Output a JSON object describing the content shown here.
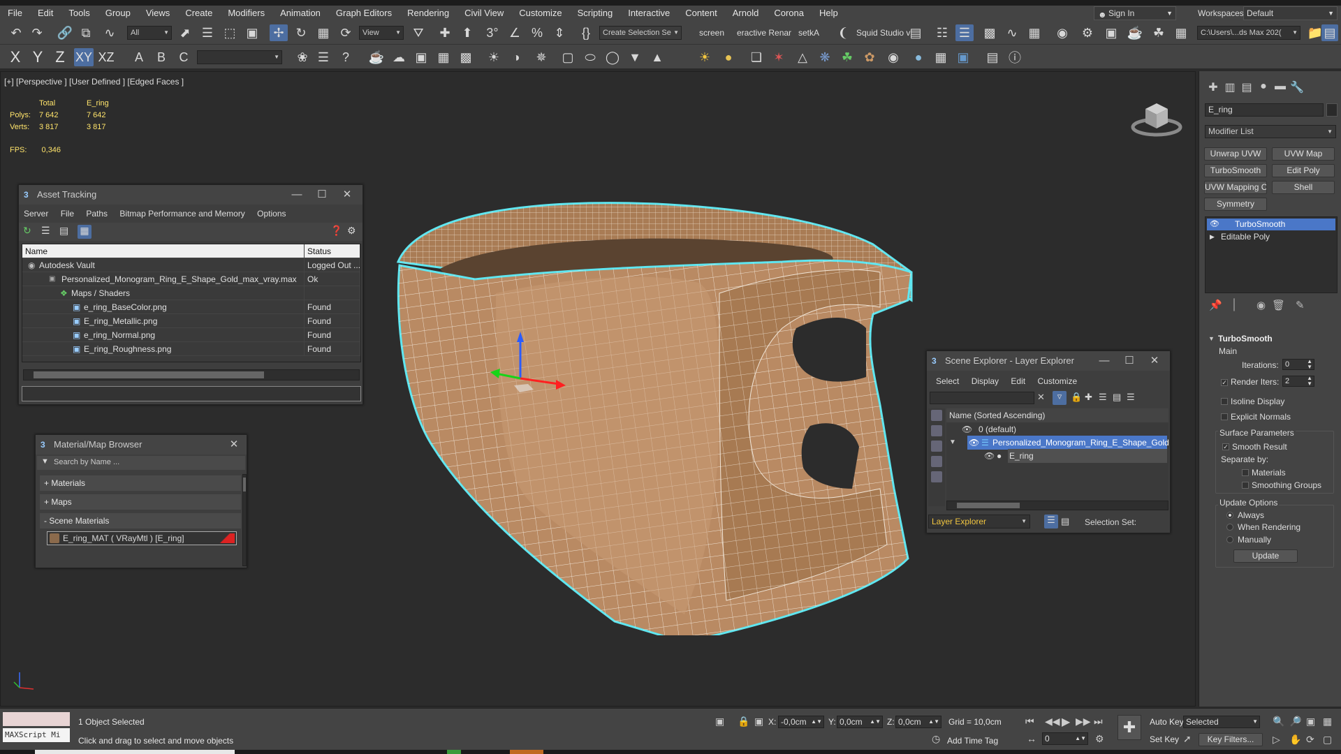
{
  "menubar": {
    "items": [
      "File",
      "Edit",
      "Tools",
      "Group",
      "Views",
      "Create",
      "Modifiers",
      "Animation",
      "Graph Editors",
      "Rendering",
      "Civil View",
      "Customize",
      "Scripting",
      "Interactive",
      "Content",
      "Arnold",
      "Corona",
      "Help"
    ],
    "signin": "Sign In",
    "workspaces_label": "Workspaces:",
    "workspace": "Default"
  },
  "toolbar": {
    "filter": "All",
    "ref_coord": "View",
    "create_selection_set": "Create Selection Se",
    "screen": "screen",
    "interactive_render": "eractive Renar",
    "setka": "setkA",
    "squid": "Squid Studio v",
    "project_path": "C:\\Users\\...ds Max 202("
  },
  "toolbar2": {
    "axes": [
      "X",
      "Y",
      "Z",
      "XY",
      "XZ"
    ]
  },
  "viewport": {
    "label": "[+] [Perspective ] [User Defined ] [Edged Faces ]",
    "stats": {
      "col_total": "Total",
      "col_object": "E_ring",
      "polys_label": "Polys:",
      "polys_total": "7 642",
      "polys_object": "7 642",
      "verts_label": "Verts:",
      "verts_total": "3 817",
      "verts_object": "3 817",
      "fps_label": "FPS:",
      "fps_value": "0,346"
    }
  },
  "asset_tracking": {
    "title": "Asset Tracking",
    "menu": [
      "Server",
      "File",
      "Paths",
      "Bitmap Performance and Memory",
      "Options"
    ],
    "col_name": "Name",
    "col_status": "Status",
    "rows": [
      {
        "name": "Autodesk Vault",
        "status": "Logged Out ..."
      },
      {
        "name": "Personalized_Monogram_Ring_E_Shape_Gold_max_vray.max",
        "status": "Ok"
      },
      {
        "name": "Maps / Shaders",
        "status": ""
      },
      {
        "name": "e_ring_BaseColor.png",
        "status": "Found"
      },
      {
        "name": "E_ring_Metallic.png",
        "status": "Found"
      },
      {
        "name": "e_ring_Normal.png",
        "status": "Found"
      },
      {
        "name": "E_ring_Roughness.png",
        "status": "Found"
      }
    ]
  },
  "material_browser": {
    "title": "Material/Map Browser",
    "search_placeholder": "Search by Name ...",
    "groups": [
      "+ Materials",
      "+ Maps",
      "- Scene Materials"
    ],
    "scene_material": "E_ring_MAT  ( VRayMtl )  [E_ring]"
  },
  "scene_explorer": {
    "title": "Scene Explorer - Layer Explorer",
    "menu": [
      "Select",
      "Display",
      "Edit",
      "Customize"
    ],
    "column": "Name (Sorted Ascending)",
    "rows": [
      "0 (default)",
      "Personalized_Monogram_Ring_E_Shape_Gold",
      "E_ring"
    ],
    "footer_mode": "Layer Explorer",
    "selection_set": "Selection Set:"
  },
  "command_panel": {
    "object_name": "E_ring",
    "modifier_list": "Modifier List",
    "buttons": [
      "Unwrap UVW",
      "UVW Map",
      "TurboSmooth",
      "Edit Poly",
      "UVW Mapping Clear",
      "Shell",
      "Symmetry"
    ],
    "stack": [
      "TurboSmooth",
      "Editable Poly"
    ],
    "turbosmooth": {
      "title": "TurboSmooth",
      "main": "Main",
      "iterations_label": "Iterations:",
      "iterations": "0",
      "render_iters_label": "Render Iters:",
      "render_iters": "2",
      "isoline": "Isoline Display",
      "explicit_normals": "Explicit Normals",
      "surface_params": "Surface Parameters",
      "smooth_result": "Smooth Result",
      "separate_by": "Separate by:",
      "materials": "Materials",
      "smoothing_groups": "Smoothing Groups",
      "update_options": "Update Options",
      "always": "Always",
      "when_rendering": "When Rendering",
      "manually": "Manually",
      "update": "Update"
    }
  },
  "status": {
    "maxscript": "MAXScript Mi",
    "selected": "1 Object Selected",
    "prompt": "Click and drag to select and move objects",
    "x_label": "X:",
    "x": "-0,0cm",
    "y_label": "Y:",
    "y": "0,0cm",
    "z_label": "Z:",
    "z": "0,0cm",
    "grid": "Grid = 10,0cm",
    "add_time_tag": "Add Time Tag",
    "frame": "0",
    "auto_key": "Auto Key",
    "selected_mode": "Selected",
    "set_key": "Set Key",
    "key_filters": "Key Filters..."
  },
  "colors": {
    "accent": "#4a77c8",
    "selection_outline": "#5fe6f0",
    "ring": "#b98a63",
    "stats": "#ffe46b"
  }
}
